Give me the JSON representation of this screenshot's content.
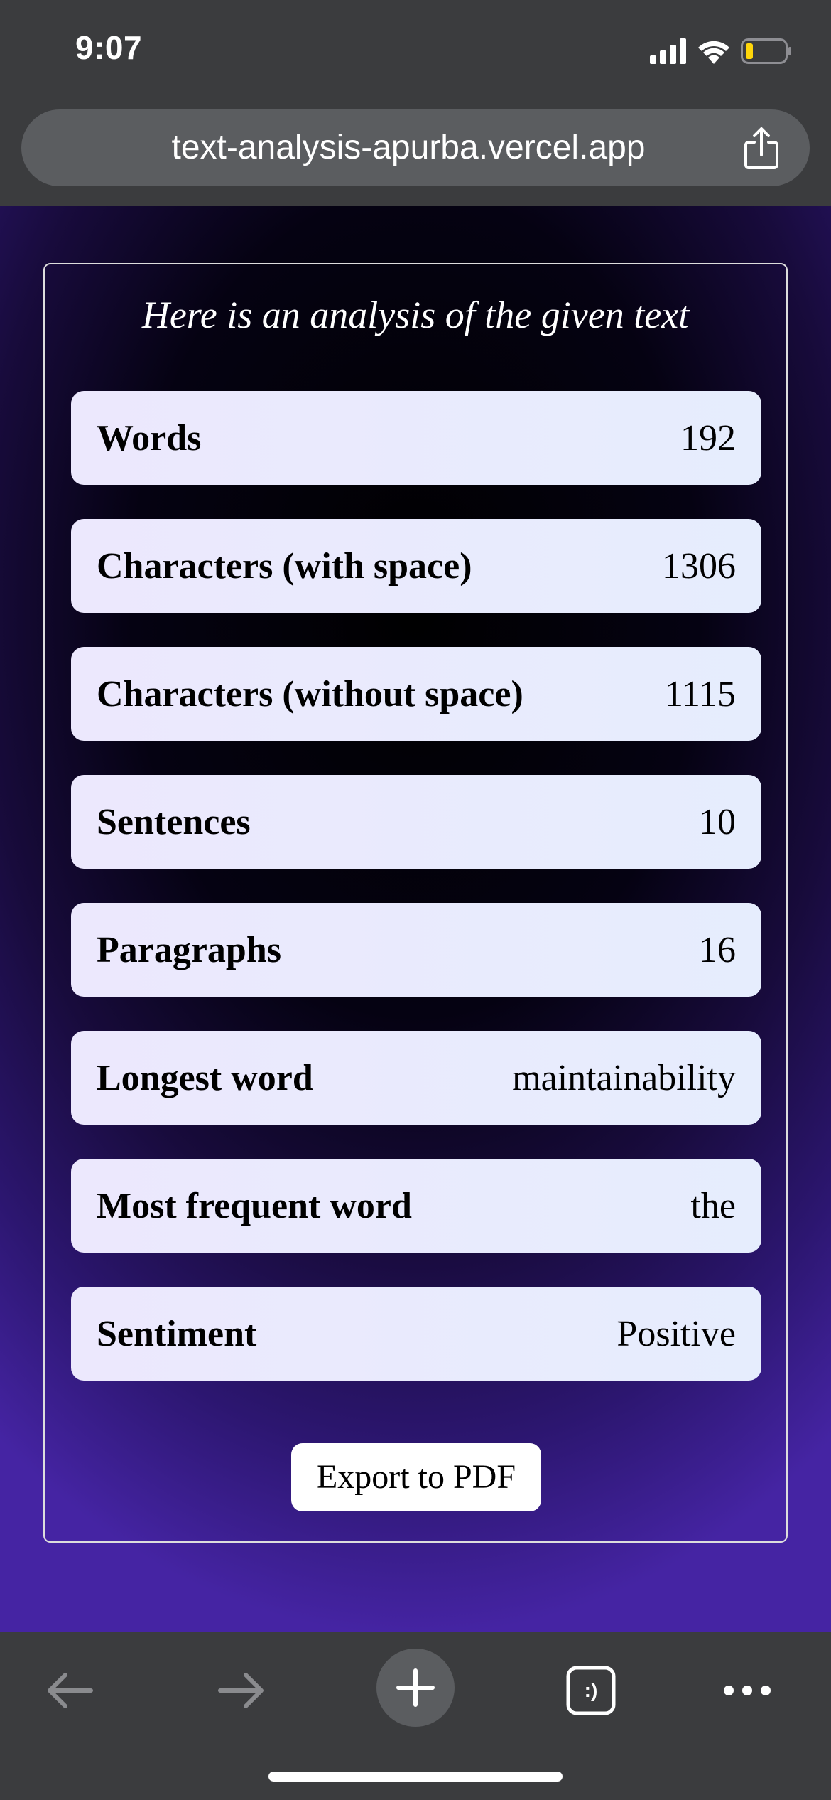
{
  "status_bar": {
    "time": "9:07",
    "icons": [
      "signal-icon",
      "wifi-icon",
      "battery-icon"
    ]
  },
  "browser": {
    "url": "text-analysis-apurba.vercel.app",
    "share_icon": "share-icon"
  },
  "analysis": {
    "heading": "Here is an analysis of the given text",
    "stats": [
      {
        "label": "Words",
        "value": "192"
      },
      {
        "label": "Characters (with space)",
        "value": "1306"
      },
      {
        "label": "Characters (without space)",
        "value": "1115"
      },
      {
        "label": "Sentences",
        "value": "10"
      },
      {
        "label": "Paragraphs",
        "value": "16"
      },
      {
        "label": "Longest word",
        "value": "maintainability"
      },
      {
        "label": "Most frequent word",
        "value": "the"
      },
      {
        "label": "Sentiment",
        "value": "Positive"
      }
    ],
    "export_label": "Export to PDF"
  },
  "toolbar": {
    "items": [
      "back-arrow-icon",
      "forward-arrow-icon",
      "new-tab-plus-icon",
      "tabs-icon",
      "more-menu-icon"
    ],
    "tabs_badge": ":)"
  },
  "colors": {
    "browser_chrome": "#3b3c3e",
    "url_bar": "#5b5d60",
    "row_background": "#e9ebfd",
    "gradient_bottom": "#4524a3"
  }
}
